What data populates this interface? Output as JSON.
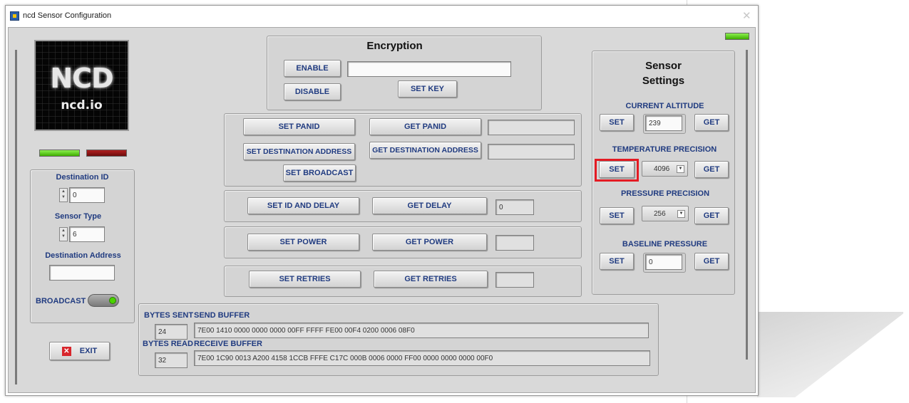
{
  "window": {
    "title": "ncd Sensor Configuration",
    "close_glyph": "✕"
  },
  "logo": {
    "big_text": "NCD",
    "small_text": "ncd.io"
  },
  "left_panel": {
    "destination_id_label": "Destination ID",
    "destination_id_value": "0",
    "sensor_type_label": "Sensor Type",
    "sensor_type_value": "6",
    "destination_address_label": "Destination Address",
    "destination_address_value": "",
    "broadcast_label": "BROADCAST"
  },
  "exit_label": "EXIT",
  "encryption": {
    "title": "Encryption",
    "enable_label": "ENABLE",
    "disable_label": "DISABLE",
    "set_key_label": "SET KEY",
    "key_value": ""
  },
  "network": {
    "set_panid": "SET PANID",
    "get_panid": "GET PANID",
    "panid_value": "",
    "set_dest_addr": "SET DESTINATION ADDRESS",
    "get_dest_addr": "GET DESTINATION ADDRESS",
    "dest_addr_value": "",
    "set_broadcast": "SET BROADCAST"
  },
  "delay": {
    "set_label": "SET ID AND DELAY",
    "get_label": "GET DELAY",
    "value": "0"
  },
  "power": {
    "set_label": "SET POWER",
    "get_label": "GET POWER",
    "value": ""
  },
  "retries": {
    "set_label": "SET RETRIES",
    "get_label": "GET RETRIES",
    "value": ""
  },
  "buffers": {
    "bytes_sent_label": "BYTES SENT",
    "bytes_sent_value": "24",
    "send_buffer_label": "SEND BUFFER",
    "send_buffer_value": "7E00 1410 0000 0000 0000 00FF FFFF FE00 00F4 0200 0006 08F0",
    "bytes_read_label": "BYTES READ",
    "bytes_read_value": "32",
    "receive_buffer_label": "RECEIVE BUFFER",
    "receive_buffer_value": "7E00 1C90 0013 A200 4158 1CCB FFFE C17C 000B 0006 0000 FF00 0000 0000 0000 00F0"
  },
  "sensor_settings": {
    "title_line1": "Sensor",
    "title_line2": "Settings",
    "set_label": "SET",
    "get_label": "GET",
    "current_altitude_label": "CURRENT ALTITUDE",
    "current_altitude_value": "239",
    "temperature_precision_label": "TEMPERATURE PRECISION",
    "temperature_precision_value": "4096",
    "pressure_precision_label": "PRESSURE PRECISION",
    "pressure_precision_value": "256",
    "baseline_pressure_label": "BASELINE PRESSURE",
    "baseline_pressure_value": "0"
  },
  "colors": {
    "led_on": "#4cd400",
    "led_off": "#8e1414",
    "label_blue": "#203b80",
    "highlight": "#e41b23"
  },
  "icons": {
    "exit": "close-x-icon",
    "dropdown": "chevron-down-icon",
    "spinner": "up-down-arrows-icon"
  }
}
